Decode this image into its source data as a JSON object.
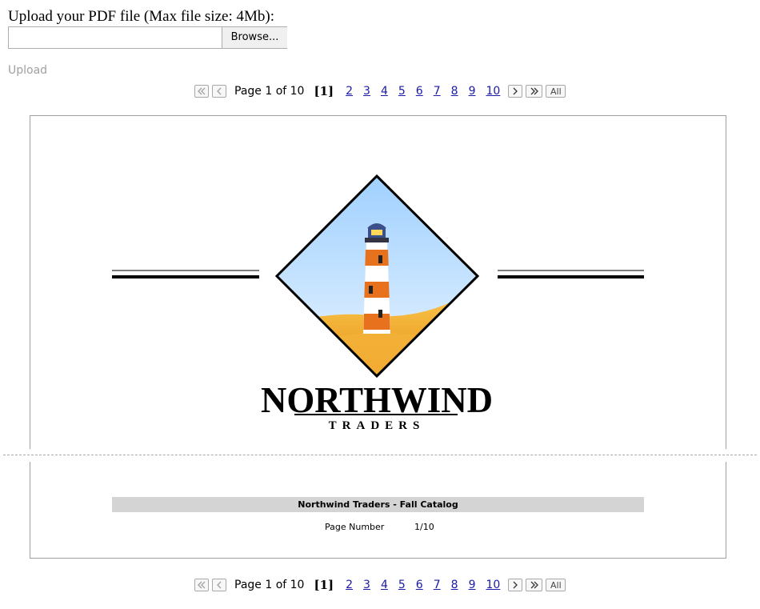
{
  "upload": {
    "label": "Upload your PDF file (Max file size: 4Mb):",
    "file_value": "",
    "browse_label": "Browse...",
    "upload_label": "Upload"
  },
  "pager": {
    "page_of": "Page 1 of 10",
    "current": "[1]",
    "pages": [
      "2",
      "3",
      "4",
      "5",
      "6",
      "7",
      "8",
      "9",
      "10"
    ],
    "all_label": "All"
  },
  "document": {
    "logo_title": "NORTHWIND",
    "logo_subtitle": "TRADERS",
    "footer_title": "Northwind Traders  - Fall Catalog",
    "page_number_label": "Page Number",
    "page_number_value": "1/10"
  },
  "colors": {
    "link": "#1a1aa6",
    "disabled": "#a0a0a0",
    "footer_bar": "#d4d4d4",
    "sky": "#bfe0ff",
    "sand": "#f2a82a",
    "lighthouse_stripe": "#e8711e"
  },
  "icons": {
    "first": "double-chevron-left-icon",
    "prev": "chevron-left-icon",
    "next": "chevron-right-icon",
    "last": "double-chevron-right-icon"
  }
}
